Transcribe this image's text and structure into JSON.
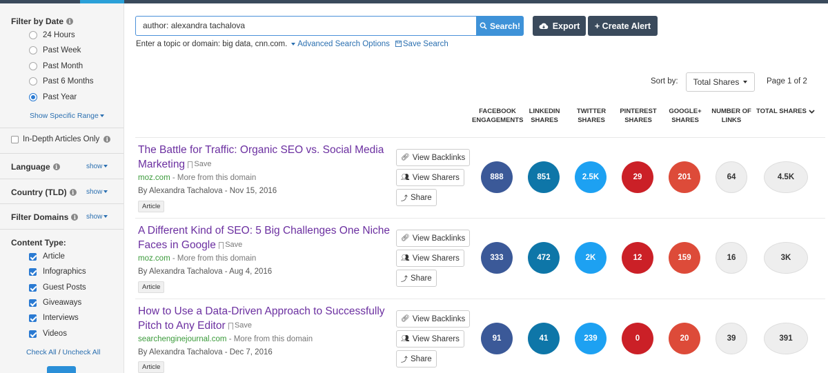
{
  "sidebar": {
    "filter_by_date": {
      "title": "Filter by Date",
      "options": [
        "24 Hours",
        "Past Week",
        "Past Month",
        "Past 6 Months",
        "Past Year"
      ],
      "selected": "Past Year",
      "show_range": "Show Specific Range"
    },
    "in_depth": "In-Depth Articles Only",
    "language": "Language",
    "country": "Country (TLD)",
    "filter_domains": "Filter Domains",
    "show": "show",
    "content_type": {
      "title": "Content Type:",
      "items": [
        "Article",
        "Infographics",
        "Guest Posts",
        "Giveaways",
        "Interviews",
        "Videos"
      ],
      "check_all": "Check All",
      "separator": "/",
      "uncheck_all": "Uncheck All"
    }
  },
  "search": {
    "value": "author: alexandra tachalova",
    "button": "Search!",
    "export": "Export",
    "create_alert": "+ Create Alert",
    "hint": "Enter a topic or domain: big data, cnn.com.",
    "advanced": "Advanced Search Options",
    "save_search": "Save Search"
  },
  "sort": {
    "label": "Sort by:",
    "value": "Total Shares",
    "page": "Page 1 of 2"
  },
  "columns": [
    "FACEBOOK ENGAGEMENTS",
    "LINKEDIN SHARES",
    "TWITTER SHARES",
    "PINTEREST SHARES",
    "GOOGLE+ SHARES",
    "NUMBER OF LINKS",
    "TOTAL SHARES"
  ],
  "actions": {
    "view_backlinks": "View Backlinks",
    "view_sharers": "View Sharers",
    "share": "Share",
    "save": "Save",
    "more_domain": "- More from this domain"
  },
  "colors": {
    "facebook": "#3b5998",
    "linkedin": "#0e76a8",
    "twitter": "#1da1f2",
    "pinterest": "#cb2027",
    "google": "#dd4b39"
  },
  "results": [
    {
      "title_1": "The Battle for Traffic: Organic SEO vs. Social Media",
      "title_2": "Marketing",
      "domain": "moz.com",
      "byline": "By Alexandra Tachalova - Nov 15, 2016",
      "tag": "Article",
      "facebook": "888",
      "linkedin": "851",
      "twitter": "2.5K",
      "pinterest": "29",
      "google": "201",
      "links": "64",
      "total": "4.5K"
    },
    {
      "title_1": "A Different Kind of SEO: 5 Big Challenges One Niche",
      "title_2": "Faces in Google",
      "domain": "moz.com",
      "byline": "By Alexandra Tachalova - Aug 4, 2016",
      "tag": "Article",
      "facebook": "333",
      "linkedin": "472",
      "twitter": "2K",
      "pinterest": "12",
      "google": "159",
      "links": "16",
      "total": "3K"
    },
    {
      "title_1": "How to Use a Data-Driven Approach to Successfully",
      "title_2": "Pitch to Any Editor",
      "domain": "searchenginejournal.com",
      "byline": "By Alexandra Tachalova - Dec 7, 2016",
      "tag": "Article",
      "facebook": "91",
      "linkedin": "41",
      "twitter": "239",
      "pinterest": "0",
      "google": "20",
      "links": "39",
      "total": "391"
    }
  ]
}
